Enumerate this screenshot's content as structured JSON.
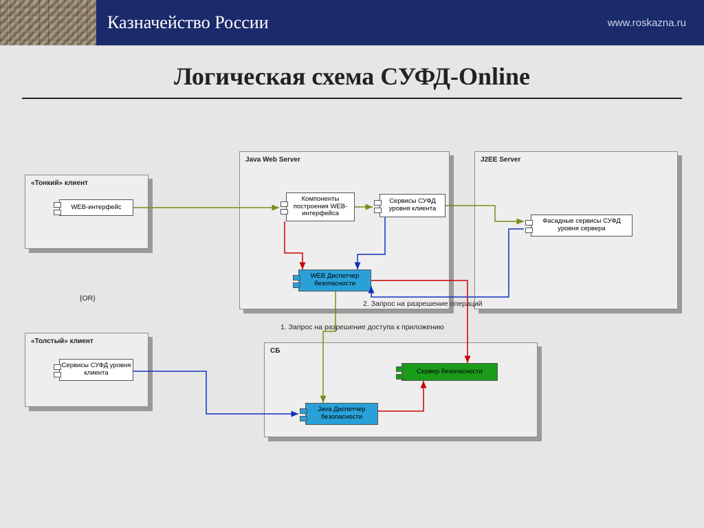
{
  "header": {
    "org": "Казначейство России",
    "url": "www.roskazna.ru"
  },
  "title": "Логическая схема СУФД-Online",
  "containers": {
    "thin": "«Тонкий» клиент",
    "thick": "«Толстый» клиент",
    "jws": "Java Web Server",
    "j2ee": "J2EE Server",
    "sb": "СБ"
  },
  "components": {
    "web_if": "WEB-интерфейс",
    "web_build": "Компоненты построения WEB-интерфейса",
    "sufd_client_svc": "Сервисы СУФД уровня клиента",
    "web_disp": "WEB Диспетчер безопасности",
    "facade": "Фасадные сервисы СУФД уровня сервера",
    "sufd_client_svc2": "Сервисы СУФД уровня клиента",
    "java_disp": "Java Диспетчер безопасности",
    "sec_server": "Сервер безопасности"
  },
  "labels": {
    "or": "{OR}",
    "note1": "1. Запрос на разрешение доступа к приложению",
    "note2": "2. Запрос на разрешение операций"
  },
  "colors": {
    "olive": "#7a8a1a",
    "blue": "#1030c0",
    "red": "#cc0000"
  }
}
